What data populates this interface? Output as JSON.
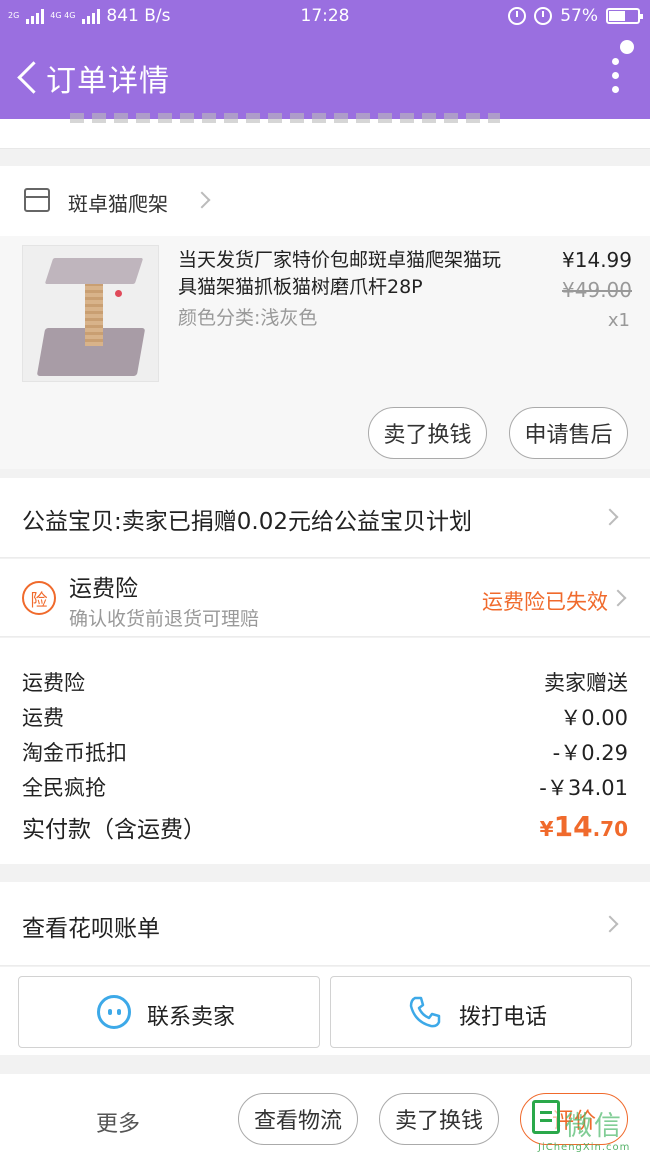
{
  "status_bar": {
    "network_left": "2G",
    "network_right": "4G 4G",
    "speed": "841 B/s",
    "time": "17:28",
    "battery": "57%",
    "battery_level": 0.57
  },
  "header": {
    "title": "订单详情"
  },
  "shop": {
    "name": "斑卓猫爬架"
  },
  "item": {
    "title": "当天发货厂家特价包邮斑卓猫爬架猫玩具猫架猫抓板猫树磨爪杆28P",
    "sku": "颜色分类:浅灰色",
    "price": "¥14.99",
    "original_price": "¥49.00",
    "quantity": "x1",
    "actions": {
      "sell": "卖了换钱",
      "after_sale": "申请售后"
    }
  },
  "charity": {
    "text": "公益宝贝:卖家已捐赠0.02元给公益宝贝计划"
  },
  "insurance": {
    "badge": "险",
    "name": "运费险",
    "subtitle": "确认收货前退货可理赔",
    "status": "运费险已失效"
  },
  "summary": {
    "rows": [
      {
        "label": "运费险",
        "value": "卖家赠送"
      },
      {
        "label": "运费",
        "value": "￥0.00"
      },
      {
        "label": "淘金币抵扣",
        "value": "-￥0.29"
      },
      {
        "label": "全民疯抢",
        "value": "-￥34.01"
      }
    ],
    "total": {
      "label": "实付款（含运费）",
      "currency": "¥",
      "integer": "14",
      "decimal": ".70"
    }
  },
  "huabei": {
    "text": "查看花呗账单"
  },
  "contacts": {
    "contact_seller": "联系卖家",
    "call": "拨打电话"
  },
  "bottom_bar": {
    "more": "更多",
    "logistics": "查看物流",
    "sell": "卖了换钱",
    "evaluate": "评价"
  },
  "watermark": {
    "text": "微信",
    "url": "JiChengXin.com"
  },
  "colors": {
    "header": "#9a6fe0",
    "accent": "#f06a2c",
    "chat_icon": "#3da9e8"
  }
}
